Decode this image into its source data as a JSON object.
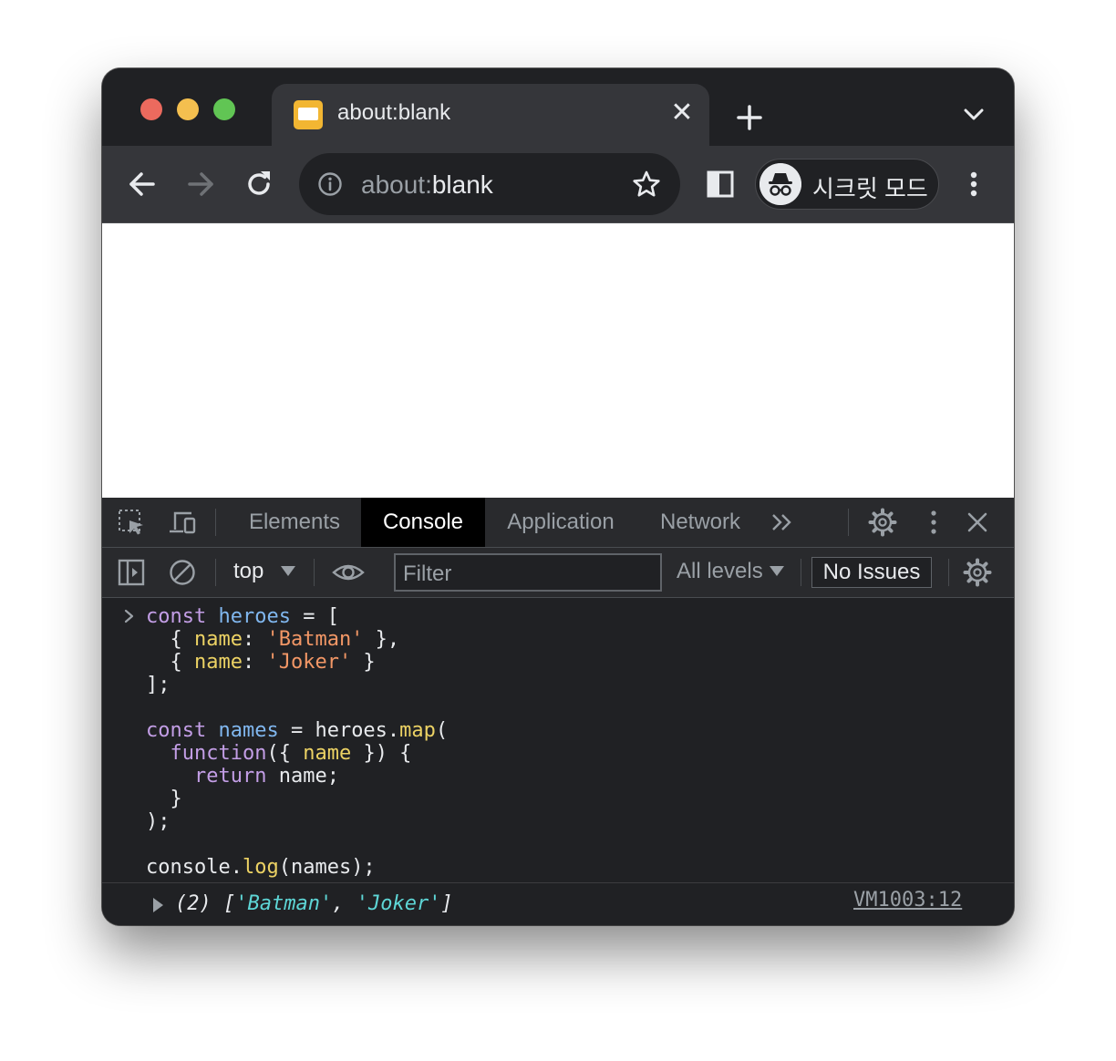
{
  "tab": {
    "title": "about:blank",
    "close_label": "✕"
  },
  "omnibox": {
    "scheme": "about:",
    "host": "blank"
  },
  "incognito": {
    "label": "시크릿 모드"
  },
  "devtools": {
    "tabs": [
      "Elements",
      "Console",
      "Application",
      "Network"
    ],
    "active_tab": "Console",
    "context": "top",
    "filter_placeholder": "Filter",
    "levels": "All levels",
    "issues": "No Issues"
  },
  "console": {
    "code_lines": [
      "const heroes = [",
      "  { name: 'Batman' },",
      "  { name: 'Joker' }",
      "];",
      "",
      "const names = heroes.map(",
      "  function({ name }) {",
      "    return name;",
      "  }",
      ");",
      "",
      "console.log(names);"
    ],
    "output": {
      "count": "(2)",
      "values": [
        "Batman",
        "Joker"
      ]
    },
    "source": "VM1003:12"
  },
  "colors": {
    "keyword": "#c39ee6",
    "variable": "#80b7ef",
    "property": "#ecd264",
    "string": "#f29766",
    "output_string": "#5ed6d6"
  }
}
